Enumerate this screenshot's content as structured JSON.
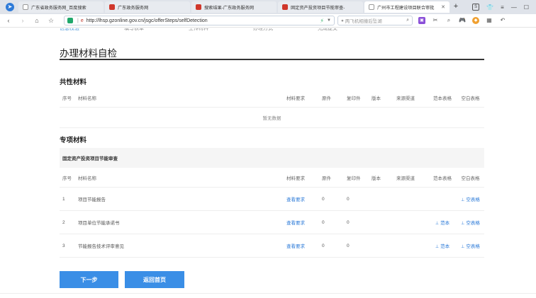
{
  "browser": {
    "tabs": [
      {
        "label": "广东省政务服务网_百度搜索",
        "favicon": "doc",
        "active": false
      },
      {
        "label": "广东政务服务网",
        "favicon": "gov",
        "active": false
      },
      {
        "label": "搜索结果-广东政务服务网",
        "favicon": "gov",
        "active": false
      },
      {
        "label": "固定资产投资项目节能审查-",
        "favicon": "gov",
        "active": false
      },
      {
        "label": "广州市工程建设项目联合审批",
        "favicon": "doc",
        "active": true
      }
    ],
    "url": "http://lhsp.gzonline.gov.cn/jsgc/offerSteps/selfDetection",
    "search_placeholder": "两飞机相撞后坠湖"
  },
  "steps": [
    "信息校验",
    "填写表单",
    "上传材料",
    "办理方式",
    "完成提交"
  ],
  "page": {
    "title": "办理材料自检",
    "common_section_title": "共性材料",
    "special_section_title": "专项材料",
    "empty_text": "暂无数据",
    "group_name": "固定资产投资项目节能审查",
    "headers": {
      "no": "序号",
      "name": "材料名称",
      "requirement": "材料要求",
      "original": "原件",
      "copy": "复印件",
      "version": "版本",
      "source": "来源渠道",
      "sample": "范本表格",
      "blank": "空白表格"
    },
    "rows": [
      {
        "no": "1",
        "name": "项目节能报告",
        "requirement": "查看要求",
        "original": "0",
        "copy": "0",
        "sample": "",
        "blank": "空表格"
      },
      {
        "no": "2",
        "name": "项目单位节能承诺书",
        "requirement": "查看要求",
        "original": "0",
        "copy": "0",
        "sample": "范本",
        "blank": "空表格"
      },
      {
        "no": "3",
        "name": "节能报告技术评审意见",
        "requirement": "查看要求",
        "original": "0",
        "copy": "0",
        "sample": "范本",
        "blank": "空表格"
      }
    ],
    "next_button": "下一步",
    "home_button": "返回首页"
  }
}
